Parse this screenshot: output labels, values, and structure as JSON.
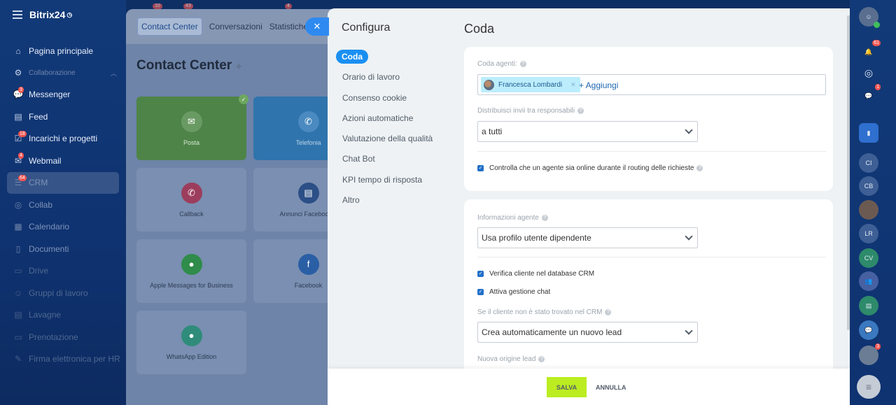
{
  "app": {
    "name": "Bitrix24"
  },
  "sidebar": {
    "items": [
      {
        "label": "Pagina principale",
        "icon": "home-icon",
        "badge": ""
      },
      {
        "label": "Collaborazione",
        "icon": "collab-section-icon",
        "badge": ""
      },
      {
        "label": "Messenger",
        "icon": "chat-icon",
        "badge": "3"
      },
      {
        "label": "Feed",
        "icon": "feed-icon",
        "badge": ""
      },
      {
        "label": "Incarichi e progetti",
        "icon": "tasks-icon",
        "badge": "18"
      },
      {
        "label": "Webmail",
        "icon": "mail-icon",
        "badge": "4"
      },
      {
        "label": "CRM",
        "icon": "crm-icon",
        "badge": "64"
      },
      {
        "label": "Collab",
        "icon": "collab-icon",
        "badge": ""
      },
      {
        "label": "Calendario",
        "icon": "calendar-icon",
        "badge": ""
      },
      {
        "label": "Documenti",
        "icon": "documents-icon",
        "badge": ""
      },
      {
        "label": "Drive",
        "icon": "drive-icon",
        "badge": ""
      },
      {
        "label": "Gruppi di lavoro",
        "icon": "groups-icon",
        "badge": ""
      },
      {
        "label": "Lavagne",
        "icon": "boards-icon",
        "badge": ""
      },
      {
        "label": "Prenotazione",
        "icon": "booking-icon",
        "badge": ""
      },
      {
        "label": "Firma elettronica per HR",
        "icon": "signature-icon",
        "badge": ""
      }
    ]
  },
  "top_badges": [
    "10",
    "43",
    "4"
  ],
  "background_page": {
    "tabs": [
      "Contact Center",
      "Conversazioni",
      "Statistiche"
    ],
    "title": "Contact Center",
    "tiles": [
      "Posta",
      "Telefonia",
      "Callback",
      "Annunci Facebook p",
      "Apple Messages for Business",
      "Facebook",
      "WhatsApp Edition"
    ]
  },
  "slider": {
    "config_title": "Configura",
    "menu": [
      "Coda",
      "Orario di lavoro",
      "Consenso cookie",
      "Azioni automatiche",
      "Valutazione della qualità",
      "Chat Bot",
      "KPI tempo di risposta",
      "Altro"
    ],
    "main_title": "Coda",
    "queue": {
      "agents_label": "Coda agenti:",
      "agent_name": "Francesca Lombardi",
      "add_label": "+ Aggiungi",
      "distribute_label": "Distribuisci invii tra responsabili",
      "distribute_value": "a tutti",
      "online_check_label": "Controlla che un agente sia online durante il routing delle richieste"
    },
    "agent_info": {
      "label": "Informazioni agente",
      "value": "Usa profilo utente dipendente",
      "verify_crm_label": "Verifica cliente nel database CRM",
      "chat_mgmt_label": "Attiva gestione chat",
      "not_found_label": "Se il cliente non è stato trovato nel CRM",
      "not_found_value": "Crea automaticamente un nuovo lead",
      "new_lead_source_label": "Nuova origine lead"
    },
    "footer": {
      "save": "SALVA",
      "cancel": "ANNULLA"
    }
  },
  "rightbar": {
    "notifications_badge": "61",
    "chat_badge": "1",
    "avatars": [
      "CI",
      "CB",
      "LR",
      "CV"
    ],
    "bottom_badge": "3"
  },
  "colors": {
    "accent": "#1a8ff2",
    "save": "#bbed21",
    "sidebar": "#123a78"
  }
}
